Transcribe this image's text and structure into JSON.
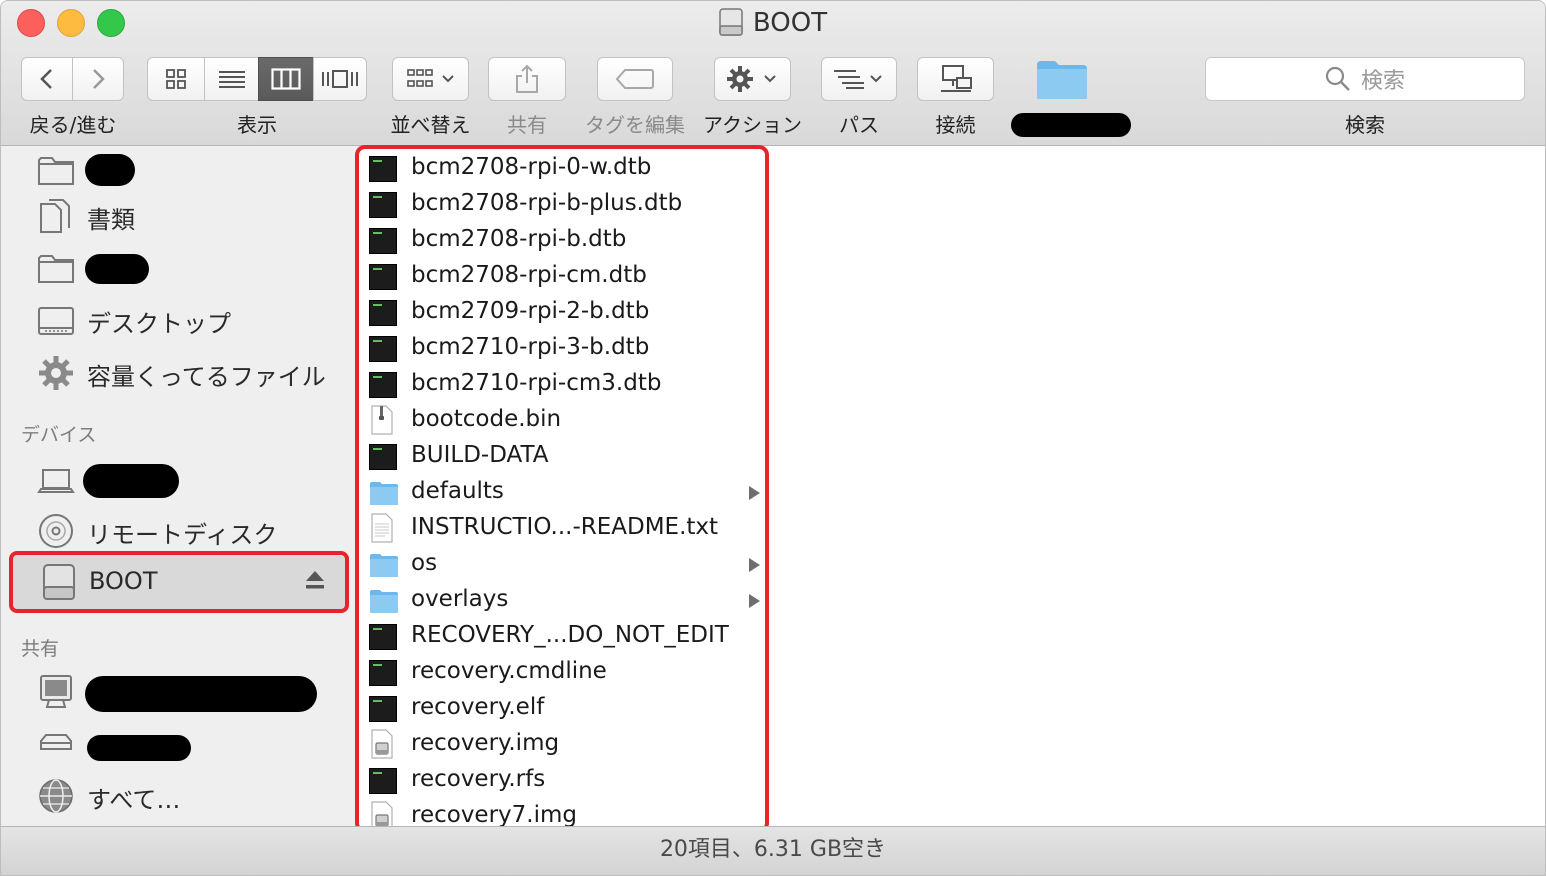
{
  "window": {
    "title": "BOOT"
  },
  "toolbar": {
    "back_forward_label": "戻る/進む",
    "view_label": "表示",
    "arrange_label": "並べ替え",
    "share_label": "共有",
    "edit_tags_label": "タグを編集",
    "action_label": "アクション",
    "path_label": "パス",
    "connect_label": "接続",
    "search_label": "検索",
    "search_placeholder": "検索"
  },
  "sidebar": {
    "items_top": [
      {
        "label": "",
        "icon": "folder-icon",
        "redacted": true
      },
      {
        "label": "書類",
        "icon": "documents-icon"
      },
      {
        "label": "",
        "icon": "folder-icon",
        "redacted": true
      },
      {
        "label": "デスクトップ",
        "icon": "desktop-icon"
      },
      {
        "label": "容量くってるファイル",
        "icon": "gear-icon"
      }
    ],
    "devices_header": "デバイス",
    "devices": [
      {
        "label": "",
        "icon": "laptop-icon",
        "redacted": true
      },
      {
        "label": "リモートディスク",
        "icon": "disc-icon"
      },
      {
        "label": "BOOT",
        "icon": "drive-icon",
        "selected": true
      }
    ],
    "shared_header": "共有",
    "shared": [
      {
        "label": "",
        "icon": "monitor-icon",
        "redacted": true
      },
      {
        "label": "",
        "icon": "server-icon",
        "redacted": true
      },
      {
        "label": "すべて…",
        "icon": "network-icon"
      }
    ]
  },
  "files": [
    {
      "name": "bcm2708-rpi-0-w.dtb",
      "icon": "exec"
    },
    {
      "name": "bcm2708-rpi-b-plus.dtb",
      "icon": "exec"
    },
    {
      "name": "bcm2708-rpi-b.dtb",
      "icon": "exec"
    },
    {
      "name": "bcm2708-rpi-cm.dtb",
      "icon": "exec"
    },
    {
      "name": "bcm2709-rpi-2-b.dtb",
      "icon": "exec"
    },
    {
      "name": "bcm2710-rpi-3-b.dtb",
      "icon": "exec"
    },
    {
      "name": "bcm2710-rpi-cm3.dtb",
      "icon": "exec"
    },
    {
      "name": "bootcode.bin",
      "icon": "archive"
    },
    {
      "name": "BUILD-DATA",
      "icon": "exec"
    },
    {
      "name": "defaults",
      "icon": "folder",
      "has_children": true
    },
    {
      "name": "INSTRUCTIO...-README.txt",
      "icon": "text"
    },
    {
      "name": "os",
      "icon": "folder",
      "has_children": true
    },
    {
      "name": "overlays",
      "icon": "folder",
      "has_children": true
    },
    {
      "name": "RECOVERY_...DO_NOT_EDIT",
      "icon": "exec"
    },
    {
      "name": "recovery.cmdline",
      "icon": "exec"
    },
    {
      "name": "recovery.elf",
      "icon": "exec"
    },
    {
      "name": "recovery.img",
      "icon": "image"
    },
    {
      "name": "recovery.rfs",
      "icon": "exec"
    },
    {
      "name": "recovery7.img",
      "icon": "image"
    }
  ],
  "status": {
    "text": "20項目、6.31 GB空き"
  },
  "colors": {
    "highlight": "#e8232b",
    "folder": "#6cb8ec"
  }
}
